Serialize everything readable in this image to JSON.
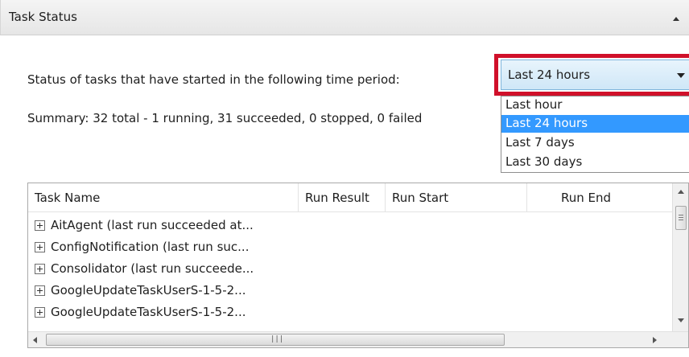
{
  "panel": {
    "title": "Task Status"
  },
  "status_prompt": "Status of tasks that have started in the following time period:",
  "summary": "Summary: 32 total - 1 running, 31 succeeded, 0 stopped, 0 failed",
  "time_period_combo": {
    "selected": "Last 24 hours",
    "options": [
      "Last hour",
      "Last 24 hours",
      "Last 7 days",
      "Last 30 days"
    ],
    "highlight_index": 1,
    "highlight_color": "#3399ff",
    "annotation_color": "#d0102a"
  },
  "task_table": {
    "columns": [
      "Task Name",
      "Run Result",
      "Run Start",
      "Run End"
    ],
    "rows": [
      "AitAgent (last run succeeded at...",
      "ConfigNotification (last run suc...",
      "Consolidator (last run succeede...",
      "GoogleUpdateTaskUserS-1-5-2...",
      "GoogleUpdateTaskUserS-1-5-2..."
    ]
  }
}
